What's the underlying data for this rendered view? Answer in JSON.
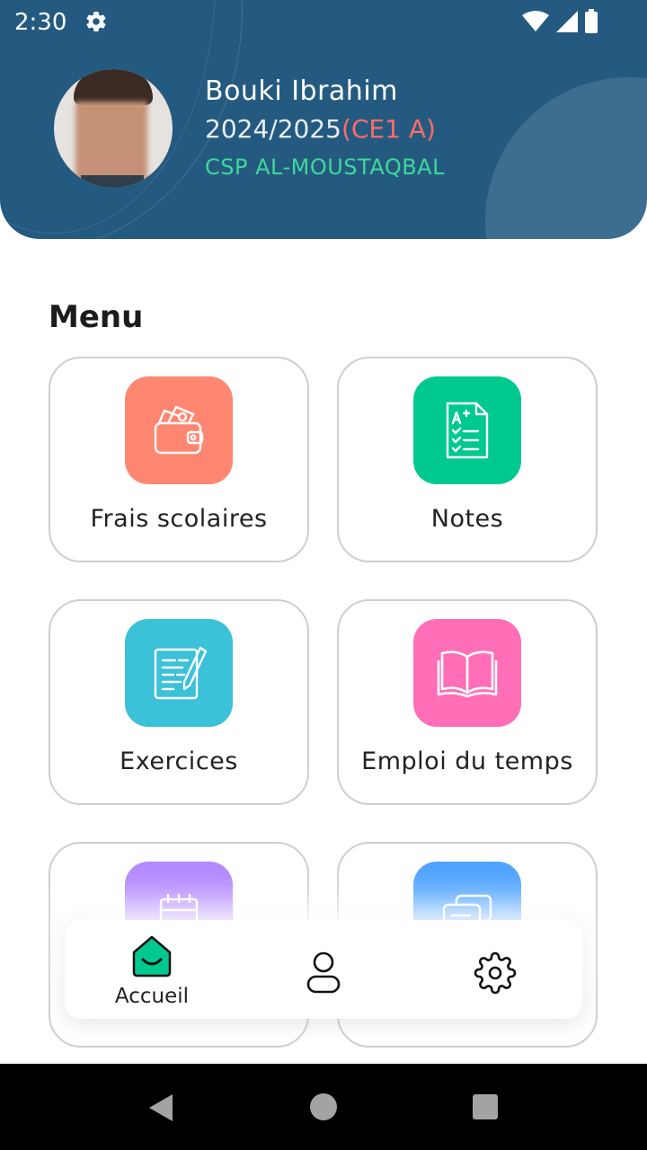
{
  "status_bar": {
    "time": "2:30",
    "icons": [
      "gear-icon",
      "wifi-icon",
      "signal-icon",
      "battery-icon"
    ]
  },
  "profile": {
    "name": "Bouki Ibrahim",
    "year": "2024/2025",
    "class": "(CE1 A)",
    "school": "CSP AL-MOUSTAQBAL"
  },
  "menu": {
    "title": "Menu",
    "items": [
      {
        "label": "Frais scolaires",
        "icon": "wallet-icon",
        "color": "#ff8671"
      },
      {
        "label": "Notes",
        "icon": "grade-sheet-icon",
        "color": "#00c98f"
      },
      {
        "label": "Exercices",
        "icon": "notepad-pencil-icon",
        "color": "#3bc1d8"
      },
      {
        "label": "Emploi du temps",
        "icon": "open-book-icon",
        "color": "#ff6eb6"
      },
      {
        "label": "",
        "icon": "calendar-icon",
        "color": "#b489ff"
      },
      {
        "label": "",
        "icon": "chat-icon",
        "color": "#4fa3ff"
      }
    ]
  },
  "bottom_nav": {
    "home_label": "Accueil",
    "accent": "#00c98f",
    "items": [
      "home-icon",
      "user-icon",
      "settings-icon"
    ]
  },
  "colors": {
    "header": "#245a80",
    "class_text": "#ff6b6b",
    "school_text": "#3fd89b"
  }
}
